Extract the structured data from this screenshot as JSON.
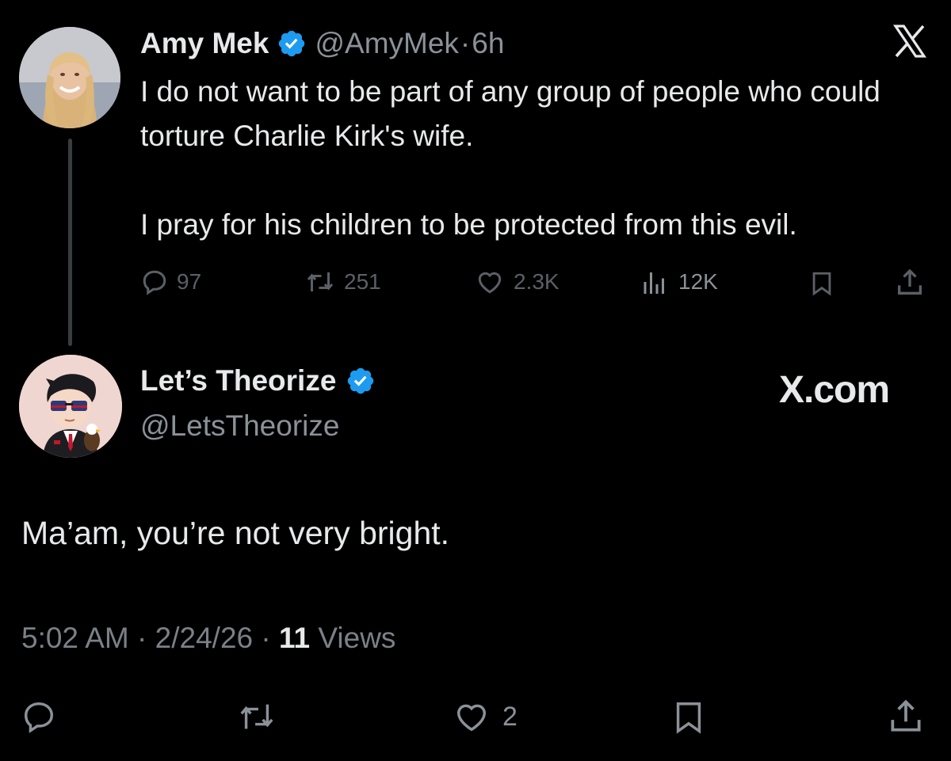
{
  "parent_tweet": {
    "author_name": "Amy Mek",
    "handle": "@AmyMek",
    "separator": "·",
    "time_ago": "6h",
    "text": "I do not want to be part of any group of people who could torture Charlie Kirk's wife.\n\nI pray for his children to be protected from this evil.",
    "metrics": {
      "replies": "97",
      "reposts": "251",
      "likes": "2.3K",
      "views": "12K"
    }
  },
  "reply_tweet": {
    "author_name": "Let’s Theorize",
    "handle": "@LetsTheorize",
    "watermark": "X.com",
    "text": "Ma’am, you’re not very bright.",
    "time": "5:02 AM",
    "date": "2/24/26",
    "separator": "·",
    "views_count": "11",
    "views_label": "Views",
    "metrics": {
      "likes": "2"
    }
  },
  "colors": {
    "background": "#000000",
    "text_primary": "#e7e9ea",
    "text_secondary": "#8b9198",
    "verified_blue": "#1d9bf0",
    "thread_line": "#3a3d40"
  },
  "icons": {
    "verified": "verified-badge-icon",
    "x_logo": "x-logo-icon",
    "reply": "reply-icon",
    "repost": "repost-icon",
    "like": "heart-icon",
    "views": "views-icon",
    "bookmark": "bookmark-icon",
    "share": "share-icon"
  }
}
